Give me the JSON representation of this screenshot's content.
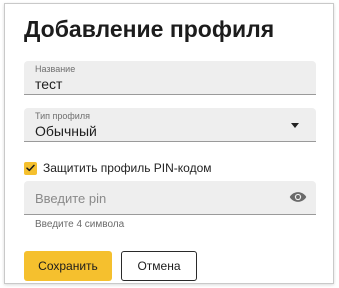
{
  "dialog": {
    "title": "Добавление профиля"
  },
  "name_field": {
    "label": "Название",
    "value": "тест"
  },
  "type_field": {
    "label": "Тип профиля",
    "value": "Обычный",
    "icon": "dropdown-caret-icon"
  },
  "pin_protect": {
    "checked": true,
    "label": "Защитить профиль PIN-кодом",
    "icon": "checkmark-icon"
  },
  "pin_field": {
    "placeholder": "Введите pin",
    "hint": "Введите 4 символа",
    "icon": "eye-icon"
  },
  "actions": {
    "save_label": "Сохранить",
    "cancel_label": "Отмена"
  },
  "colors": {
    "accent": "#f5c02e",
    "field_background": "#eeeeee",
    "text": "#1c1c1c"
  }
}
